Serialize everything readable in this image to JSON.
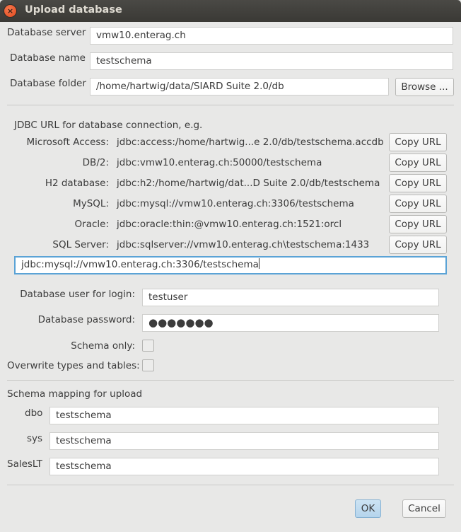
{
  "window": {
    "title": "Upload database",
    "close_icon": "×"
  },
  "connection": {
    "server_label": "Database server",
    "server_value": "vmw10.enterag.ch",
    "name_label": "Database name",
    "name_value": "testschema",
    "folder_label": "Database folder",
    "folder_value": "/home/hartwig/data/SIARD Suite 2.0/db",
    "browse_label": "Browse ..."
  },
  "jdbc": {
    "heading": "JDBC URL for database connection, e.g.",
    "rows": [
      {
        "label": "Microsoft Access:",
        "url": "jdbc:access:/home/hartwig...e 2.0/db/testschema.accdb",
        "button": "Copy URL"
      },
      {
        "label": "DB/2:",
        "url": "jdbc:vmw10.enterag.ch:50000/testschema",
        "button": "Copy URL"
      },
      {
        "label": "H2 database:",
        "url": "jdbc:h2:/home/hartwig/dat...D Suite 2.0/db/testschema",
        "button": "Copy URL"
      },
      {
        "label": "MySQL:",
        "url": "jdbc:mysql://vmw10.enterag.ch:3306/testschema",
        "button": "Copy URL"
      },
      {
        "label": "Oracle:",
        "url": "jdbc:oracle:thin:@vmw10.enterag.ch:1521:orcl",
        "button": "Copy URL"
      },
      {
        "label": "SQL Server:",
        "url": "jdbc:sqlserver://vmw10.enterag.ch\\testschema:1433",
        "button": "Copy URL"
      }
    ],
    "current_url": "jdbc:mysql://vmw10.enterag.ch:3306/testschema"
  },
  "login": {
    "user_label": "Database user for login:",
    "user_value": "testuser",
    "password_label": "Database password:",
    "password_value": "●●●●●●●",
    "schema_only_label": "Schema only:",
    "schema_only_checked": false,
    "overwrite_label": "Overwrite types and tables:",
    "overwrite_checked": false
  },
  "mapping": {
    "heading": "Schema mapping for upload",
    "rows": [
      {
        "schema": "dbo",
        "target": "testschema"
      },
      {
        "schema": "sys",
        "target": "testschema"
      },
      {
        "schema": "SalesLT",
        "target": "testschema"
      }
    ]
  },
  "footer": {
    "ok_label": "OK",
    "cancel_label": "Cancel"
  },
  "colors": {
    "focus_border": "#5ba3d6",
    "default_button": "#b5d4ec",
    "close_button": "#e0471c"
  }
}
